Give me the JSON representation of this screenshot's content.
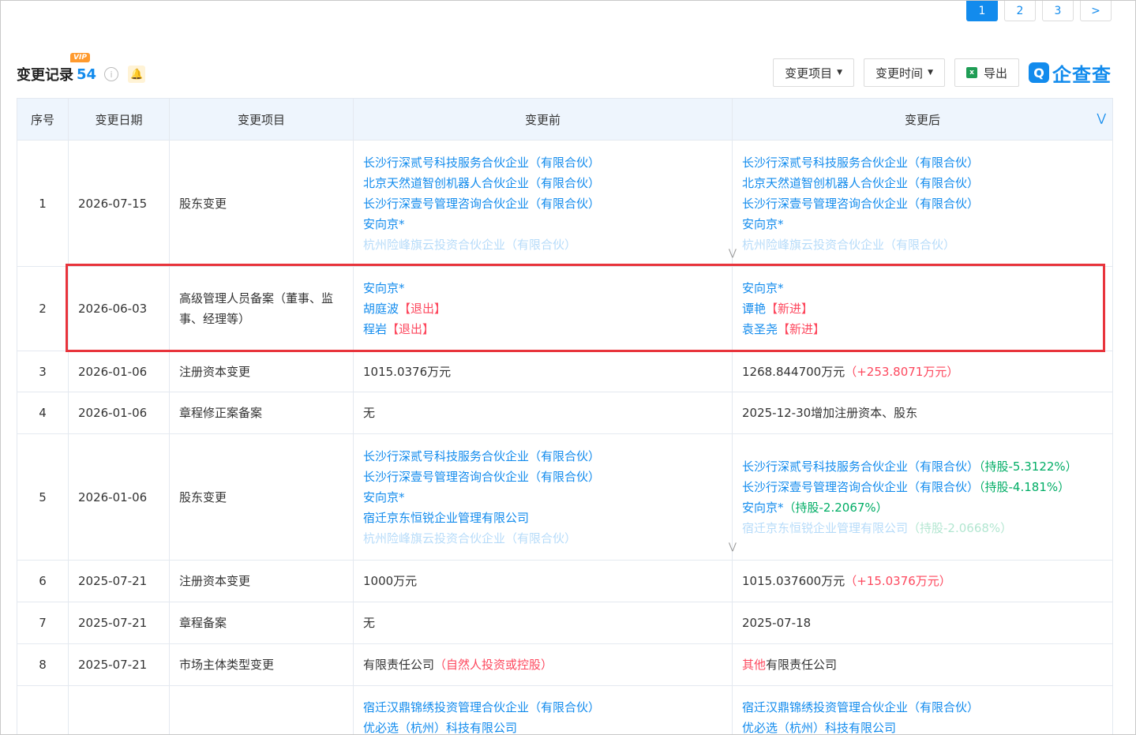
{
  "pagination": {
    "pages": [
      "1",
      "2",
      "3",
      ">"
    ],
    "active": "1"
  },
  "header": {
    "vip": "VIP",
    "title": "变更记录",
    "count": "54",
    "info_icon": "info-icon",
    "bell_icon": "bell-icon"
  },
  "toolbar": {
    "filter_item": "变更项目",
    "filter_time": "变更时间",
    "export": "导出",
    "brand": "企查查"
  },
  "columns": [
    "序号",
    "变更日期",
    "变更项目",
    "变更前",
    "变更后"
  ],
  "rows": [
    {
      "no": "1",
      "date": "2026-07-15",
      "item": "股东变更",
      "before": [
        "长沙行深贰号科技服务合伙企业（有限合伙）",
        "北京天然道智创机器人合伙企业（有限合伙）",
        "长沙行深壹号管理咨询合伙企业（有限合伙）",
        "安向京*",
        "杭州险峰旗云投资合伙企业（有限合伙）"
      ],
      "after": [
        "长沙行深贰号科技服务合伙企业（有限合伙）",
        "北京天然道智创机器人合伙企业（有限合伙）",
        "长沙行深壹号管理咨询合伙企业（有限合伙）",
        "安向京*",
        "杭州险峰旗云投资合伙企业（有限合伙）"
      ]
    },
    {
      "no": "2",
      "date": "2026-06-03",
      "item": "高级管理人员备案（董事、监事、经理等）",
      "before": [
        {
          "name": "安向京*",
          "tag": ""
        },
        {
          "name": "胡庭波",
          "tag": "【退出】"
        },
        {
          "name": "程岩",
          "tag": "【退出】"
        }
      ],
      "after": [
        {
          "name": "安向京*",
          "tag": ""
        },
        {
          "name": "谭艳",
          "tag": "【新进】"
        },
        {
          "name": "袁圣尧",
          "tag": "【新进】"
        }
      ]
    },
    {
      "no": "3",
      "date": "2026-01-06",
      "item": "注册资本变更",
      "before": "1015.0376万元",
      "after": "1268.844700万元",
      "after_note": "（+253.8071万元）"
    },
    {
      "no": "4",
      "date": "2026-01-06",
      "item": "章程修正案备案",
      "before": "无",
      "after": "2025-12-30增加注册资本、股东"
    },
    {
      "no": "5",
      "date": "2026-01-06",
      "item": "股东变更",
      "before": [
        "长沙行深贰号科技服务合伙企业（有限合伙）",
        "长沙行深壹号管理咨询合伙企业（有限合伙）",
        "安向京*",
        "宿迁京东恒锐企业管理有限公司",
        "杭州险峰旗云投资合伙企业（有限合伙）"
      ],
      "after": [
        {
          "name": "长沙行深贰号科技服务合伙企业（有限合伙）",
          "share": "（持股-5.3122%）"
        },
        {
          "name": "长沙行深壹号管理咨询合伙企业（有限合伙）",
          "share": "（持股-4.181%）"
        },
        {
          "name": "安向京*",
          "share": "（持股-2.2067%）"
        },
        {
          "name": "宿迁京东恒锐企业管理有限公司",
          "share": "（持股-2.0668%）"
        }
      ]
    },
    {
      "no": "6",
      "date": "2025-07-21",
      "item": "注册资本变更",
      "before": "1000万元",
      "after": "1015.037600万元",
      "after_note": "（+15.0376万元）"
    },
    {
      "no": "7",
      "date": "2025-07-21",
      "item": "章程备案",
      "before": "无",
      "after": "2025-07-18"
    },
    {
      "no": "8",
      "date": "2025-07-21",
      "item": "市场主体类型变更",
      "before": "有限责任公司",
      "before_note": "（自然人投资或控股）",
      "after_prefix": "其他",
      "after": "有限责任公司"
    },
    {
      "no": "",
      "date": "",
      "item": "",
      "before": [
        "宿迁汉鼎锦绣投资管理合伙企业（有限合伙）",
        "优必选（杭州）科技有限公司"
      ],
      "after": [
        "宿迁汉鼎锦绣投资管理合伙企业（有限合伙）",
        "优必选（杭州）科技有限公司"
      ]
    }
  ],
  "colors": {
    "accent": "#128bed",
    "red": "#fd485e",
    "green": "#00ad65",
    "highlight": "#e8343c"
  }
}
